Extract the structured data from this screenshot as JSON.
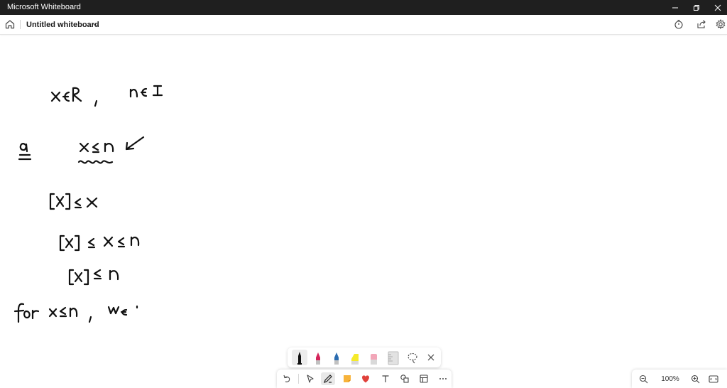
{
  "window": {
    "app_title": "Microsoft Whiteboard",
    "controls": [
      "minimize-icon",
      "restore-icon",
      "close-icon"
    ]
  },
  "header": {
    "board_title": "Untitled whiteboard",
    "left_icons": [
      "home-icon",
      "chevron-down-icon"
    ],
    "right_icons": [
      "timer-icon",
      "share-icon",
      "gear-icon"
    ]
  },
  "pen_tray": {
    "tools": [
      {
        "name": "pen-black",
        "color": "#111111"
      },
      {
        "name": "pen-red",
        "color": "#d4245a"
      },
      {
        "name": "pen-blue",
        "color": "#2b6cb0"
      },
      {
        "name": "highlighter-yellow",
        "color": "#f5ea2a"
      },
      {
        "name": "eraser",
        "color": "#f2a6b8"
      },
      {
        "name": "ruler",
        "color": "#cfcfcf"
      }
    ],
    "actions": [
      "lasso-icon",
      "close-icon"
    ]
  },
  "toolbar": {
    "buttons": [
      "undo-icon",
      "select-icon",
      "pen-icon",
      "sticky-note-icon",
      "reactions-icon",
      "text-icon",
      "shapes-icon",
      "templates-icon",
      "more-icon"
    ],
    "active": "pen-icon"
  },
  "zoom": {
    "level": "100%",
    "icons": [
      "zoom-out-icon",
      "zoom-in-icon",
      "fit-screen-icon"
    ]
  },
  "colors": {
    "titlebar_bg": "#1f1f1f",
    "ink": "#111111",
    "sticky": "#f7b33b",
    "reaction": "#e0413b"
  },
  "ink_handwriting": [
    "x∈R , n∈I",
    "a) x ≤ n",
    "[x] ≤ x",
    "[x] ≤ x ≤ n",
    "[x] ≤ n",
    "for x ≤ n , we"
  ]
}
